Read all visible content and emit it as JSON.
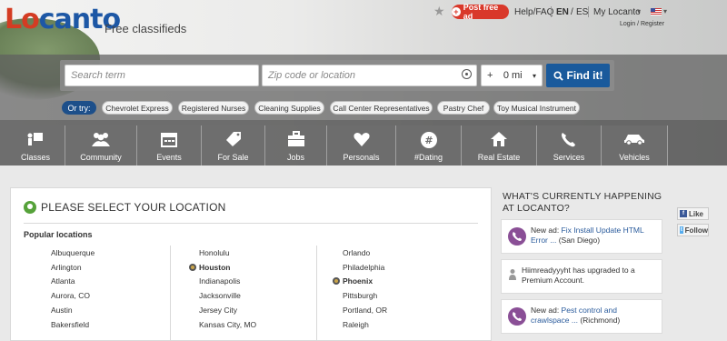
{
  "brand": {
    "logo_a": "Lo",
    "logo_b": "canto",
    "tagline": "Free classifieds"
  },
  "topbar": {
    "post_ad": "Post free ad",
    "help": "Help/FAQ",
    "lang_en": "EN",
    "lang_es": "ES",
    "my_locanto": "My Locanto",
    "login_register": "Login / Register"
  },
  "search": {
    "term_placeholder": "Search term",
    "zip_placeholder": "Zip code or location",
    "distance": "0 mi",
    "find_label": "Find it!"
  },
  "or_try": {
    "label": "Or try:",
    "suggestions": [
      "Chevrolet Express",
      "Registered Nurses",
      "Cleaning Supplies",
      "Call Center Representatives",
      "Pastry Chef",
      "Toy Musical Instrument"
    ]
  },
  "categories": [
    "Classes",
    "Community",
    "Events",
    "For Sale",
    "Jobs",
    "Personals",
    "#Dating",
    "Real Estate",
    "Services",
    "Vehicles"
  ],
  "location": {
    "title": "PLEASE SELECT YOUR LOCATION",
    "popular": "Popular locations",
    "col1": [
      "Albuquerque",
      "Arlington",
      "Atlanta",
      "Aurora, CO",
      "Austin",
      "Bakersfield"
    ],
    "col2": [
      "Honolulu",
      "Houston",
      "Indianapolis",
      "Jacksonville",
      "Jersey City",
      "Kansas City, MO"
    ],
    "col3": [
      "Orlando",
      "Philadelphia",
      "Phoenix",
      "Pittsburgh",
      "Portland, OR",
      "Raleigh"
    ]
  },
  "sidebar": {
    "title_line1": "WHAT'S CURRENTLY HAPPENING",
    "title_line2": "AT LOCANTO?",
    "card1_prefix": "New ad: ",
    "card1_text": "Fix Install Update HTML Error ...",
    "card1_suffix": " (San Diego)",
    "card2_text": "Hiimreadyyyht has upgraded to a Premium Account.",
    "card3_prefix": "New ad: ",
    "card3_text": "Pest control and crawlspace ...",
    "card3_suffix": " (Richmond)",
    "like": "Like",
    "follow": "Follow"
  },
  "colors": {
    "accent": "#1a5a9c",
    "post": "#d9382a",
    "pin": "#56a23a",
    "phone": "#8a4f96"
  },
  "icons": [
    "star-icon",
    "plus-icon",
    "flag-icon",
    "target-icon",
    "search-icon",
    "location-pin-icon",
    "phone-icon",
    "facebook-icon",
    "twitter-icon"
  ]
}
